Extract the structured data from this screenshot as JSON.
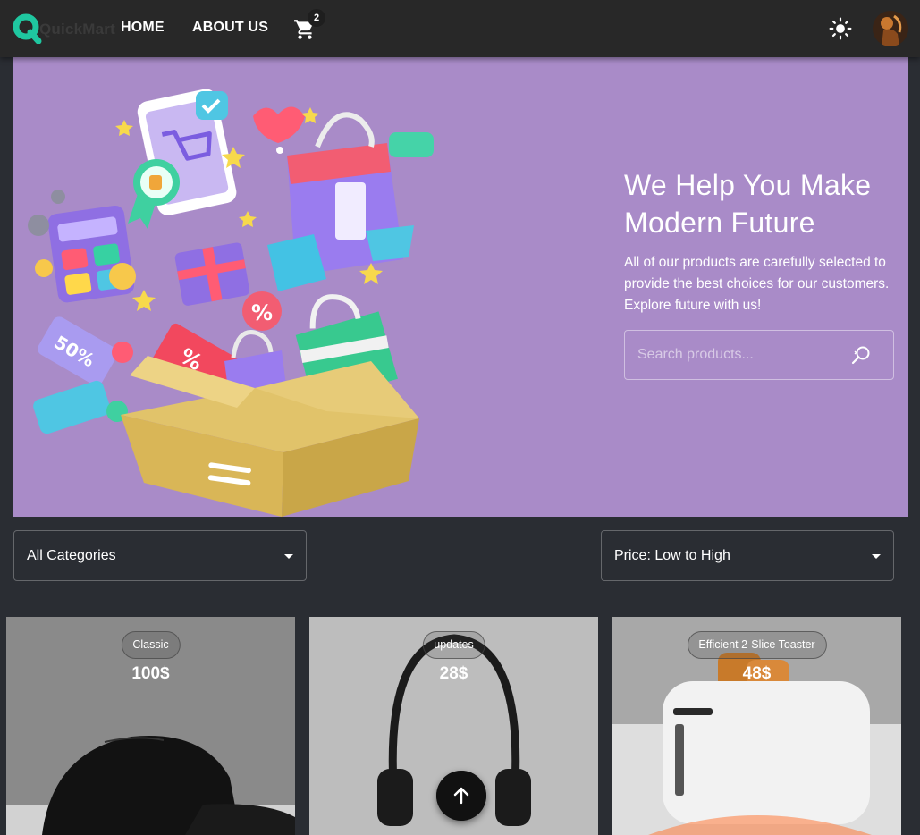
{
  "header": {
    "logo_text": "QuickMart",
    "nav": {
      "home": "HOME",
      "about": "ABOUT US"
    },
    "cart_count": "2",
    "icons": {
      "cart": "cart-icon",
      "theme": "sun-icon",
      "avatar": "avatar"
    }
  },
  "hero": {
    "title": "We Help You Make Modern Future",
    "subtitle": "All of our products are carefully selected to provide the best choices for our customers. Explore future with us!",
    "search_placeholder": "Search products...",
    "background": "#a98bc8"
  },
  "filters": {
    "category": "All Categories",
    "sort": "Price: Low to High"
  },
  "products": [
    {
      "name": "Classic",
      "price": "100$"
    },
    {
      "name": "updates",
      "price": "28$"
    },
    {
      "name": "Efficient 2-Slice Toaster",
      "price": "48$"
    }
  ],
  "colors": {
    "accent": "#1fc7a0",
    "header_bg": "#282828",
    "page_bg": "#2a2d33"
  }
}
